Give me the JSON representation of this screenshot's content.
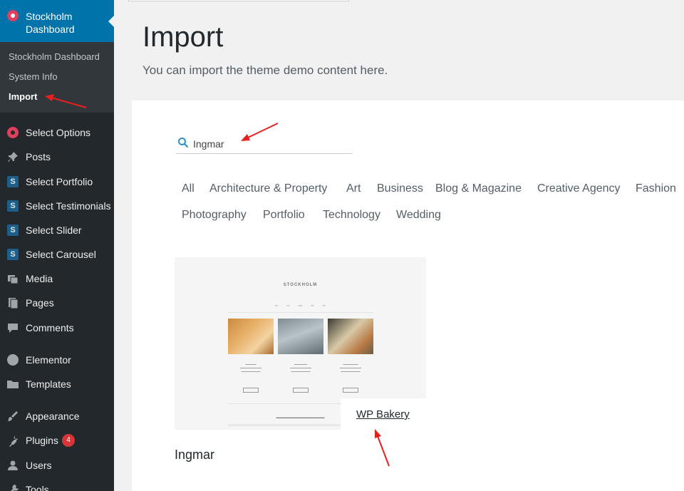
{
  "sidebar": {
    "active_menu": "Stockholm Dashboard",
    "submenu": [
      "Stockholm Dashboard",
      "System Info",
      "Import"
    ],
    "current_submenu": "Import",
    "items": [
      {
        "label": "Select Options",
        "icon": "select-options-icon"
      },
      {
        "label": "Posts",
        "icon": "pin-icon"
      },
      {
        "label": "Select Portfolio",
        "icon": "s-icon"
      },
      {
        "label": "Select Testimonials",
        "icon": "s-icon"
      },
      {
        "label": "Select Slider",
        "icon": "s-icon"
      },
      {
        "label": "Select Carousel",
        "icon": "s-icon"
      },
      {
        "label": "Media",
        "icon": "media-icon"
      },
      {
        "label": "Pages",
        "icon": "pages-icon"
      },
      {
        "label": "Comments",
        "icon": "comment-icon"
      },
      {
        "label": "Elementor",
        "icon": "elementor-icon"
      },
      {
        "label": "Templates",
        "icon": "folder-icon"
      },
      {
        "label": "Appearance",
        "icon": "brush-icon"
      },
      {
        "label": "Plugins",
        "icon": "plugin-icon",
        "badge": "4"
      },
      {
        "label": "Users",
        "icon": "users-icon"
      },
      {
        "label": "Tools",
        "icon": "wrench-icon"
      }
    ]
  },
  "header": {
    "title": "Import",
    "subtitle": "You can import the theme demo content here."
  },
  "search": {
    "value": "Ingmar",
    "icon": "search-icon"
  },
  "categories": [
    "All",
    "Architecture & Property",
    "Art",
    "Business",
    "Blog & Magazine",
    "Creative Agency",
    "Fashion",
    "Photography",
    "Portfolio",
    "Technology",
    "Wedding"
  ],
  "demo": {
    "name": "Ingmar",
    "builder": "WP Bakery",
    "thumb_logo": "STOCKHOLM"
  },
  "colors": {
    "sidebar_bg": "#23282d",
    "active_bg": "#0073aa",
    "annotation_arrow": "#e8201d"
  }
}
